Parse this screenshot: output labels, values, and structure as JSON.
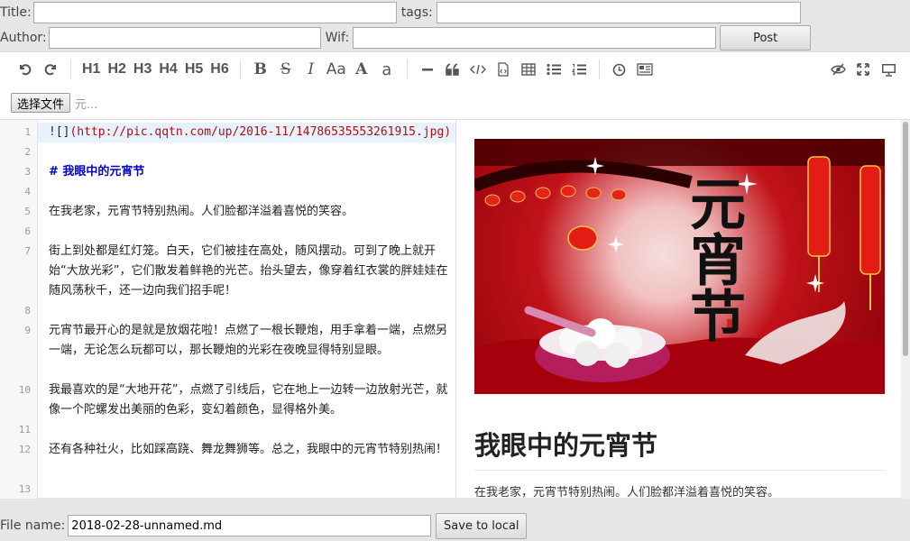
{
  "form": {
    "title_label": "Title:",
    "title_value": "",
    "tags_label": "tags:",
    "tags_value": "",
    "author_label": "Author:",
    "author_value": "",
    "wif_label": "Wif:",
    "wif_value": "",
    "post_button": "Post"
  },
  "toolbar": {
    "headings": [
      "H1",
      "H2",
      "H3",
      "H4",
      "H5",
      "H6"
    ],
    "text_styles": [
      "Aa",
      "A",
      "a"
    ]
  },
  "upload": {
    "choose_file_label": "选择文件",
    "file_name": "元..."
  },
  "editor": {
    "line_numbers": [
      "1",
      "2",
      "3",
      "4",
      "5",
      "6",
      "7",
      "8",
      "9",
      "10",
      "11",
      "12",
      "13"
    ],
    "line1_bracket": "![]",
    "line1_url": "(http://pic.qqtn.com/up/2016-11/14786535553261915.jpg)",
    "line3": "# 我眼中的元宵节",
    "line5": "在我老家，元宵节特别热闹。人们脸都洋溢着喜悦的笑容。",
    "line7": "街上到处都是红灯笼。白天，它们被挂在高处，随风摆动。可到了晚上就开始“大放光彩”，它们散发着鲜艳的光芒。抬头望去，像穿着红衣裳的胖娃娃在随风荡秋千，还一边向我们招手呢！",
    "line9": "元宵节最开心的是就是放烟花啦！点燃了一根长鞭炮，用手拿着一端，点燃另一端，无论怎么玩都可以，那长鞭炮的光彩在夜晚显得特别显眼。",
    "line10": "我最喜欢的是“大地开花”，点燃了引线后，它在地上一边转一边放射光芒，就像一个陀螺发出美丽的色彩，变幻着颜色，显得格外美。",
    "line12": "还有各种社火，比如踩高跷、舞龙舞狮等。总之，我眼中的元宵节特别热闹！"
  },
  "preview": {
    "poster_text": "元宵节",
    "heading": "我眼中的元宵节",
    "paragraph": "在我老家，元宵节特别热闹。人们脸都洋溢着喜悦的笑容。"
  },
  "footer": {
    "file_name_label": "File name:",
    "file_name_value": "2018-02-28-unnamed.md",
    "save_button": "Save to local"
  },
  "colors": {
    "accent_heading": "#0000cc",
    "url": "#aa1111",
    "poster_red": "#c1121a"
  }
}
